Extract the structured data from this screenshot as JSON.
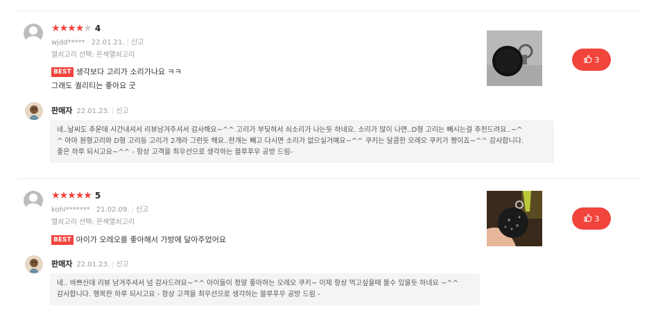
{
  "reviews": [
    {
      "stars_filled": 4,
      "stars_total": 5,
      "score": "4",
      "user": "wjdd*****",
      "date": "22.01.21.",
      "report": "신고",
      "option": "열쇠고리 선택: 은색열쇠고리",
      "best_label": "BEST",
      "lines": [
        "생각보다 고리가 소리가나요 ㅋㅋ",
        "그래도 퀄리티는 좋아요 굿"
      ],
      "likes": "3",
      "seller": {
        "name": "판매자",
        "date": "22.01.23.",
        "report": "신고",
        "reply_lines": [
          "네..날씨도 추운데 시간내셔서 리뷰남겨주셔서 감사해요~^^  고리가 부딪혀서 쇠소리가 나는듯 하네요. 소리가 많이 나면..D형 고리는 빼시는걸 추천드려요..~^",
          "^  아마 원형고리와 D형 고리등 고리가 2개라 그런듯 해요..한개는 빼고 다시면 소리가 없으실거예요~^^  쿠키는 달콤한 오레오 쿠키가 짱이죠~^^ 감사합니다.",
          "좋은 하루 되시고요~^^  - 항상 고객을 최우선으로 생각하는 블루푸우 공방 드림-"
        ]
      }
    },
    {
      "stars_filled": 5,
      "stars_total": 5,
      "score": "5",
      "user": "kohi*******",
      "date": "21.02.09.",
      "report": "신고",
      "option": "열쇠고리 선택: 은색열쇠고리",
      "best_label": "BEST",
      "lines": [
        "아이가 오레오를 좋아해서 가방에 달아주었어요"
      ],
      "likes": "3",
      "seller": {
        "name": "판매자",
        "date": "22.01.23.",
        "report": "신고",
        "reply_lines": [
          "네.. 바쁘신데 리뷰 남겨주셔서 넘 감사드려요~^^  아이들이 정말 좋아하는 오레오 쿠키~ 이제 항상 먹고싶을때 볼수 있을듯 하네요 ~^^",
          "감사합니다. 행복한 하루 되시고요 - 항상 고객을 최우선으로 생각하는 블루푸우 공방 드림 -"
        ]
      }
    }
  ],
  "icons": {
    "like": "thumbs-up-icon",
    "avatar": "user-avatar-icon",
    "star": "star-icon"
  },
  "colors": {
    "accent": "#f1443c",
    "reply_bg": "#f4f4f4"
  }
}
